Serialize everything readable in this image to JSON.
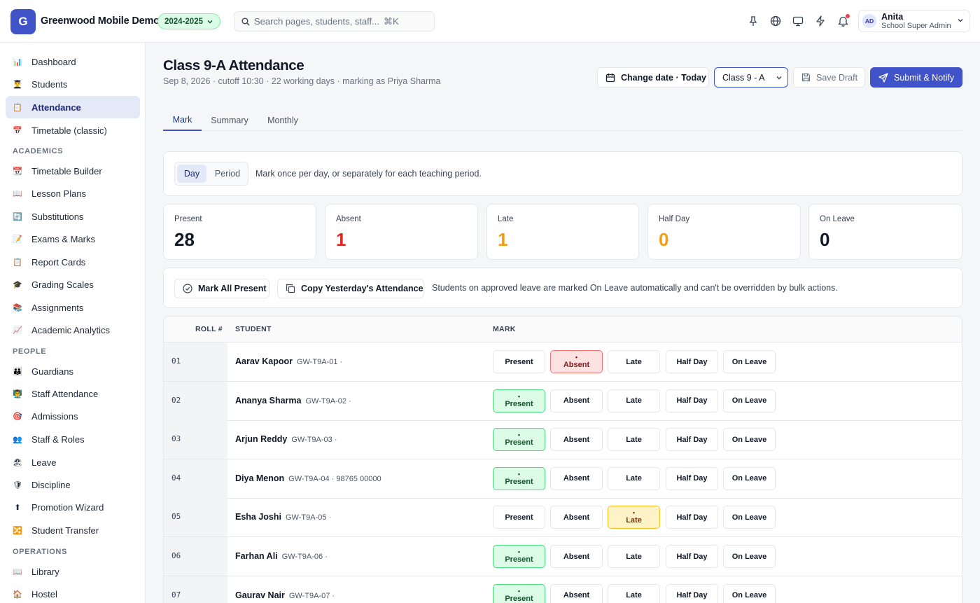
{
  "app": {
    "logo_letter": "G",
    "name": "Greenwood Mobile Demo",
    "year": "2024-2025"
  },
  "search": {
    "placeholder": "Search pages, students, staff...",
    "shortcut": "⌘K"
  },
  "user": {
    "initials": "AD",
    "name": "Anita",
    "role": "School Super Admin"
  },
  "sidebar": {
    "top": [
      {
        "label": "Dashboard",
        "icon": "📊"
      },
      {
        "label": "Students",
        "icon": "👨‍🎓"
      },
      {
        "label": "Attendance",
        "icon": "📋",
        "active": true
      },
      {
        "label": "Timetable (classic)",
        "icon": "📅"
      }
    ],
    "academics_heading": "ACADEMICS",
    "academics": [
      {
        "label": "Timetable Builder",
        "icon": "📆"
      },
      {
        "label": "Lesson Plans",
        "icon": "📖"
      },
      {
        "label": "Substitutions",
        "icon": "🔄"
      },
      {
        "label": "Exams & Marks",
        "icon": "📝"
      },
      {
        "label": "Report Cards",
        "icon": "📋"
      },
      {
        "label": "Grading Scales",
        "icon": "🎓"
      },
      {
        "label": "Assignments",
        "icon": "📚"
      },
      {
        "label": "Academic Analytics",
        "icon": "📈"
      }
    ],
    "people_heading": "PEOPLE",
    "people": [
      {
        "label": "Guardians",
        "icon": "👪"
      },
      {
        "label": "Staff Attendance",
        "icon": "👨‍🏫"
      },
      {
        "label": "Admissions",
        "icon": "🎯"
      },
      {
        "label": "Staff & Roles",
        "icon": "👥"
      },
      {
        "label": "Leave",
        "icon": "🏖"
      },
      {
        "label": "Discipline",
        "icon": "🛡"
      },
      {
        "label": "Promotion Wizard",
        "icon": "⬆"
      },
      {
        "label": "Student Transfer",
        "icon": "🔀"
      }
    ],
    "operations_heading": "OPERATIONS",
    "operations": [
      {
        "label": "Library",
        "icon": "📖"
      },
      {
        "label": "Hostel",
        "icon": "🏠"
      }
    ]
  },
  "page": {
    "title": "Class 9-A Attendance",
    "subtitle": "Sep 8, 2026 · cutoff 10:30 · 22 working days · marking as Priya Sharma",
    "change_date": "Change date · Today",
    "class_select": "Class 9 - A",
    "save_draft": "Save Draft",
    "submit": "Submit & Notify"
  },
  "tabs": [
    "Mark",
    "Summary",
    "Monthly"
  ],
  "mode": {
    "day": "Day",
    "period": "Period",
    "hint": "Mark once per day, or separately for each teaching period."
  },
  "stats": [
    {
      "label": "Present",
      "value": "28",
      "color": "#111827"
    },
    {
      "label": "Absent",
      "value": "1",
      "color": "#dc2626"
    },
    {
      "label": "Late",
      "value": "1",
      "color": "#f59e0b"
    },
    {
      "label": "Half Day",
      "value": "0",
      "color": "#f59e0b"
    },
    {
      "label": "On Leave",
      "value": "0",
      "color": "#111827"
    }
  ],
  "bulk": {
    "mark_all": "Mark All Present",
    "copy_yesterday": "Copy Yesterday's Attendance",
    "note": "Students on approved leave are marked On Leave automatically and can't be overridden by bulk actions."
  },
  "table": {
    "headers": {
      "roll": "ROLL #",
      "student": "STUDENT",
      "mark": "MARK"
    },
    "mark_options": [
      "Present",
      "Absent",
      "Late",
      "Half Day",
      "On Leave"
    ],
    "selected_dot": "•",
    "rows": [
      {
        "roll": "01",
        "name": "Aarav Kapoor",
        "meta": "GW-T9A-01 ·",
        "mark": "Absent"
      },
      {
        "roll": "02",
        "name": "Ananya Sharma",
        "meta": "GW-T9A-02 ·",
        "mark": "Present"
      },
      {
        "roll": "03",
        "name": "Arjun Reddy",
        "meta": "GW-T9A-03 ·",
        "mark": "Present"
      },
      {
        "roll": "04",
        "name": "Diya Menon",
        "meta": "GW-T9A-04 · 98765 00000",
        "mark": "Present"
      },
      {
        "roll": "05",
        "name": "Esha Joshi",
        "meta": "GW-T9A-05 ·",
        "mark": "Late"
      },
      {
        "roll": "06",
        "name": "Farhan Ali",
        "meta": "GW-T9A-06 ·",
        "mark": "Present"
      },
      {
        "roll": "07",
        "name": "Gaurav Nair",
        "meta": "GW-T9A-07 ·",
        "mark": "Present"
      }
    ]
  },
  "colors": {
    "accent": "#4153c8",
    "present_bg": "#dcfce7",
    "absent_bg": "#fee2e2",
    "late_bg": "#fef3c7"
  }
}
